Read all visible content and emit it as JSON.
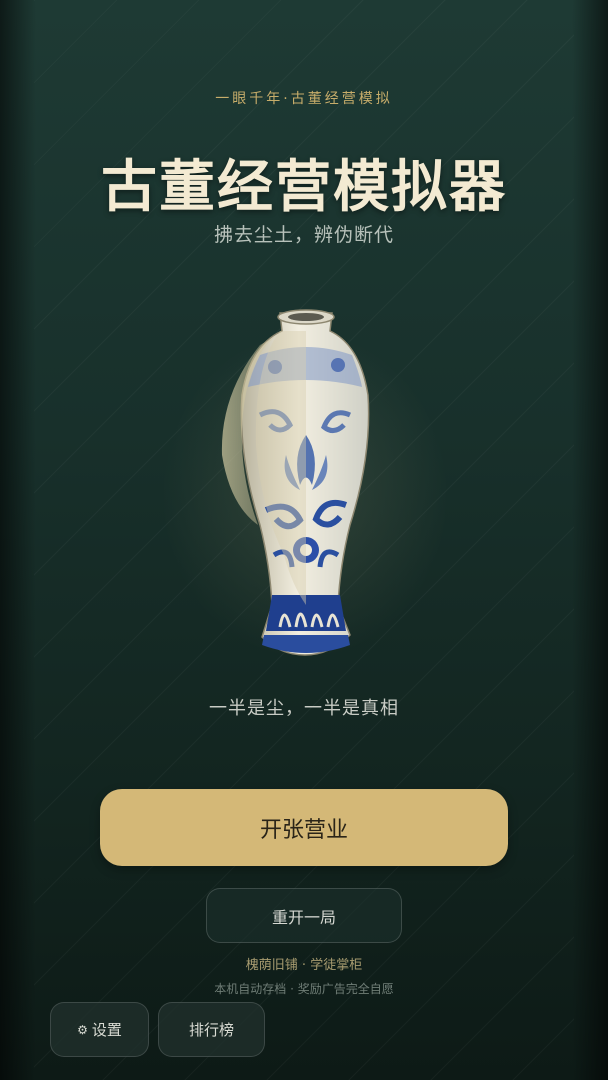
{
  "header": {
    "tagline": "一眼千年·古董经营模拟",
    "title": "古董经营模拟器",
    "subtitle": "拂去尘土，辨伪断代"
  },
  "hero": {
    "icon": "blue-and-white-porcelain-vase",
    "caption": "一半是尘，一半是真相"
  },
  "actions": {
    "open_shop": "开张营业",
    "restart": "重开一局"
  },
  "footer": {
    "shop_name": "槐荫旧铺 · 学徒掌柜",
    "save_note": "本机自动存档 · 奖励广告完全自愿",
    "settings_icon": "⚙",
    "settings": "设置",
    "leaderboard": "排行榜"
  },
  "colors": {
    "background": "#18302b",
    "accent_gold": "#d4b877",
    "title": "#f3ead2",
    "porcelain_blue": "#2c4fa8"
  }
}
